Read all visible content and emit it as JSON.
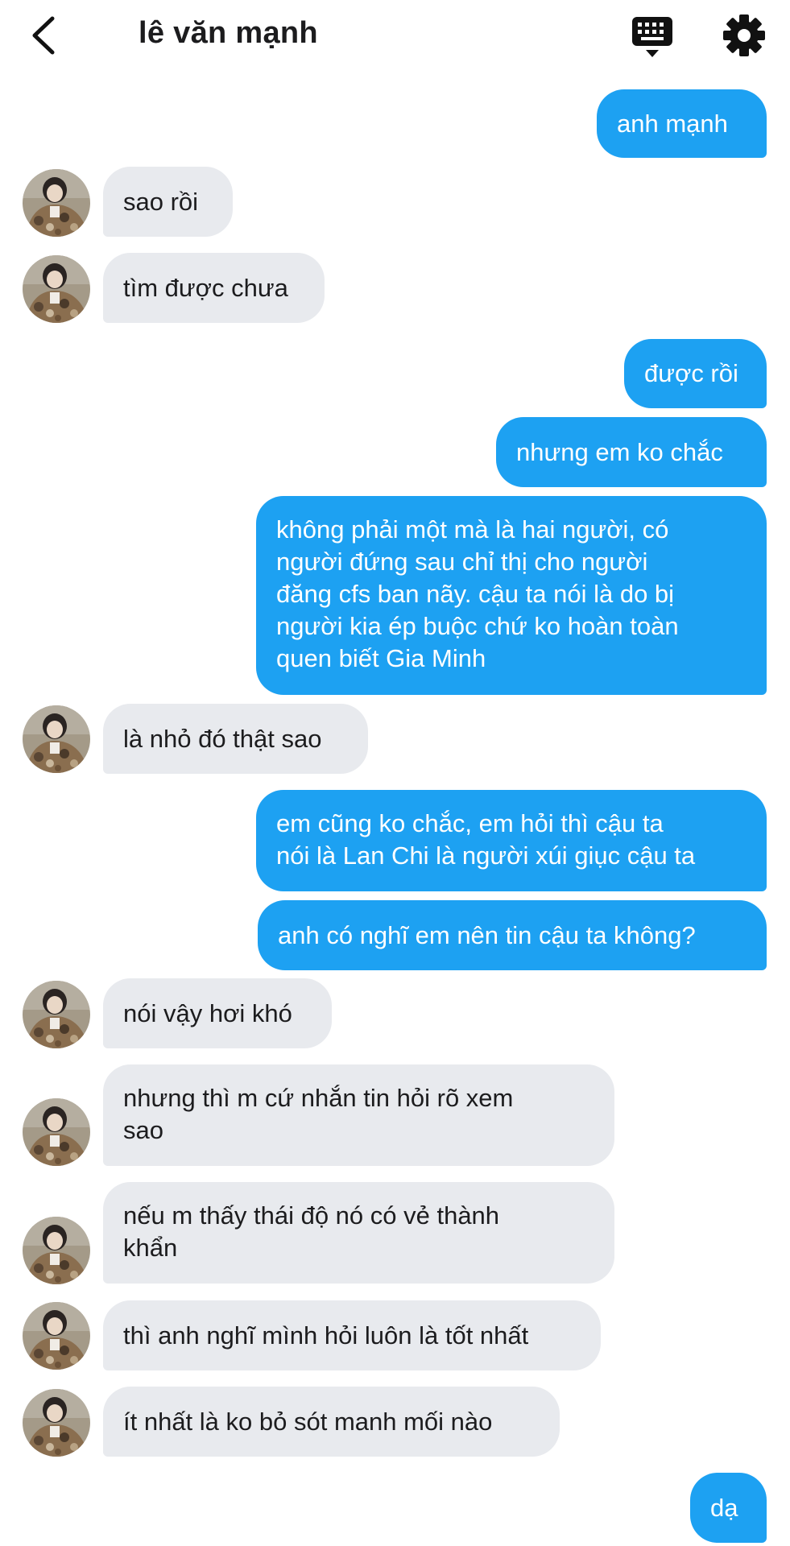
{
  "header": {
    "title": "lê văn mạnh",
    "back_icon": "chevron-left-icon",
    "keyboard_icon": "keyboard-icon",
    "settings_icon": "gear-icon"
  },
  "colors": {
    "sent_bubble": "#1da1f2",
    "received_bubble": "#e8eaee",
    "background": "#ffffff"
  },
  "messages": [
    {
      "from": "me",
      "text": "anh mạnh"
    },
    {
      "from": "contact",
      "text": "sao rồi"
    },
    {
      "from": "contact",
      "text": "tìm được chưa"
    },
    {
      "from": "me",
      "text": "được rồi"
    },
    {
      "from": "me",
      "text": "nhưng em ko chắc"
    },
    {
      "from": "me",
      "text": "không phải một mà là hai người, có\nngười đứng sau chỉ thị cho người\nđăng cfs ban nãy. cậu ta nói là do bị\nngười kia ép buộc chứ ko hoàn toàn\nquen biết Gia Minh"
    },
    {
      "from": "contact",
      "text": "là nhỏ đó thật sao"
    },
    {
      "from": "me",
      "text": "em cũng ko chắc, em hỏi thì cậu ta\nnói là Lan Chi là người xúi giục cậu ta"
    },
    {
      "from": "me",
      "text": "anh có nghĩ em nên tin cậu ta không?"
    },
    {
      "from": "contact",
      "text": "nói vậy hơi khó"
    },
    {
      "from": "contact",
      "text": "nhưng thì m cứ nhắn tin hỏi rõ xem\nsao"
    },
    {
      "from": "contact",
      "text": "nếu m thấy thái độ nó có vẻ thành\nkhẩn"
    },
    {
      "from": "contact",
      "text": "thì anh nghĩ mình hỏi luôn là tốt nhất"
    },
    {
      "from": "contact",
      "text": "ít nhất là ko bỏ sót manh mối nào"
    },
    {
      "from": "me",
      "text": "dạ"
    }
  ]
}
